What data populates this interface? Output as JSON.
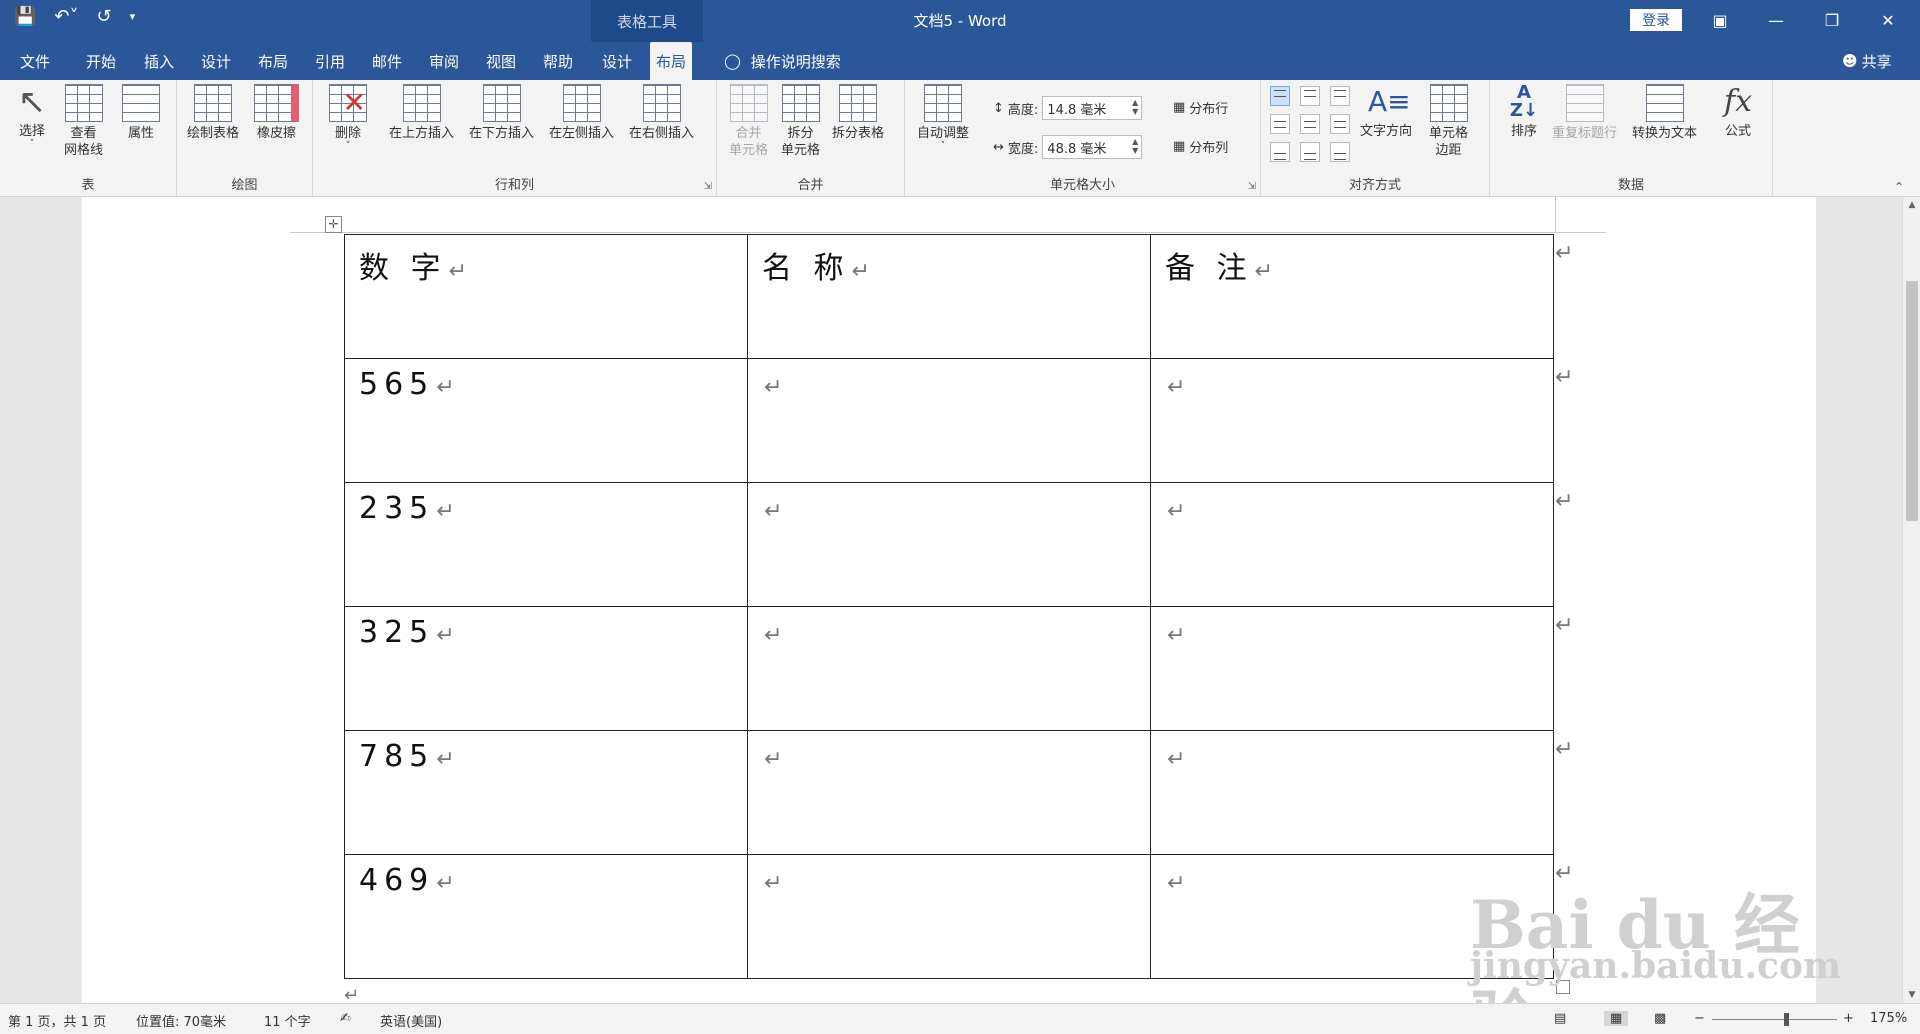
{
  "titlebar": {
    "context_tab": "表格工具",
    "doc_title": "文档5  -  Word",
    "signin": "登录",
    "qat": {
      "save": "save-icon",
      "undo": "undo-icon",
      "redo": "redo-icon",
      "customize": "customize-icon"
    },
    "window_controls": [
      "ribbon-display-icon",
      "minimize-icon",
      "restore-icon",
      "close-icon"
    ]
  },
  "menubar": {
    "items": [
      "文件",
      "开始",
      "插入",
      "设计",
      "布局",
      "引用",
      "邮件",
      "审阅",
      "视图",
      "帮助",
      "设计",
      "布局"
    ],
    "tell_me": "操作说明搜索",
    "share": "共享"
  },
  "ribbon": {
    "groups": {
      "table": {
        "label": "表",
        "select": "选择",
        "gridlines": "查看\n网格线",
        "properties": "属性"
      },
      "draw": {
        "label": "绘图",
        "draw_table": "绘制表格",
        "eraser": "橡皮擦"
      },
      "rows_cols": {
        "label": "行和列",
        "delete": "删除",
        "insert_above": "在上方插入",
        "insert_below": "在下方插入",
        "insert_left": "在左侧插入",
        "insert_right": "在右侧插入"
      },
      "merge": {
        "label": "合并",
        "merge_cells": "合并\n单元格",
        "split_cells": "拆分\n单元格",
        "split_table": "拆分表格"
      },
      "cell_size": {
        "label": "单元格大小",
        "autofit": "自动调整",
        "height_label": "高度:",
        "height_value": "14.8 毫米",
        "width_label": "宽度:",
        "width_value": "48.8 毫米",
        "distribute_rows": "分布行",
        "distribute_cols": "分布列"
      },
      "alignment": {
        "label": "对齐方式",
        "text_direction": "文字方向",
        "cell_margins": "单元格\n边距"
      },
      "data": {
        "label": "数据",
        "sort": "排序",
        "repeat_header": "重复标题行",
        "convert_to_text": "转换为文本",
        "formula": "公式"
      }
    }
  },
  "document": {
    "table": {
      "headers": [
        "数 字",
        "名 称",
        "备 注"
      ],
      "rows": [
        [
          "565",
          "",
          ""
        ],
        [
          "235",
          "",
          ""
        ],
        [
          "325",
          "",
          ""
        ],
        [
          "785",
          "",
          ""
        ],
        [
          "469",
          "",
          ""
        ]
      ]
    },
    "paragraph_mark": "↵"
  },
  "statusbar": {
    "page": "第 1 页，共 1 页",
    "position": "位置值: 70毫米",
    "words": "11 个字",
    "language": "英语(美国)",
    "zoom": "175%"
  },
  "watermark": {
    "line1": "Bai du 经验",
    "line2": "jingyan.baidu.com"
  }
}
